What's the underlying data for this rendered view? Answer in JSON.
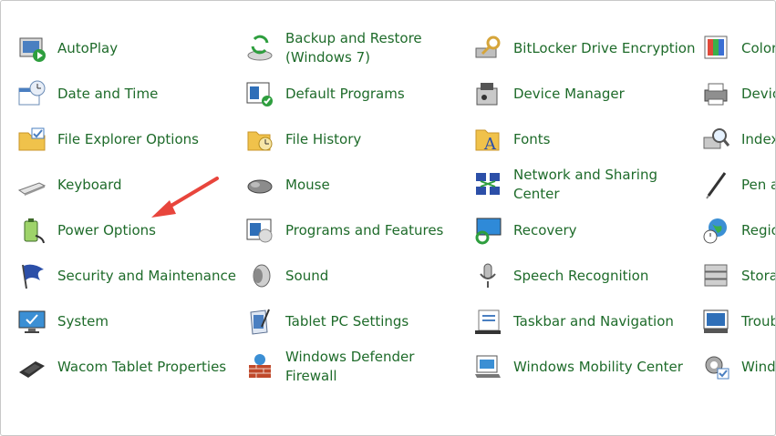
{
  "control_panel": {
    "columns": [
      {
        "items": [
          {
            "label": "AutoPlay",
            "icon": "autoplay-icon"
          },
          {
            "label": "Date and Time",
            "icon": "date-time-icon"
          },
          {
            "label": "File Explorer Options",
            "icon": "folder-options-icon"
          },
          {
            "label": "Keyboard",
            "icon": "keyboard-icon"
          },
          {
            "label": "Power Options",
            "icon": "battery-icon"
          },
          {
            "label": "Security and Maintenance",
            "icon": "flag-icon"
          },
          {
            "label": "System",
            "icon": "monitor-check-icon"
          },
          {
            "label": "Wacom Tablet Properties",
            "icon": "tablet-icon"
          }
        ]
      },
      {
        "items": [
          {
            "label": "Backup and Restore\n(Windows 7)",
            "icon": "backup-icon"
          },
          {
            "label": "Default Programs",
            "icon": "default-programs-icon"
          },
          {
            "label": "File History",
            "icon": "file-history-icon"
          },
          {
            "label": "Mouse",
            "icon": "mouse-icon"
          },
          {
            "label": "Programs and Features",
            "icon": "programs-icon"
          },
          {
            "label": "Sound",
            "icon": "speaker-icon"
          },
          {
            "label": "Tablet PC Settings",
            "icon": "tablet-pen-icon"
          },
          {
            "label": "Windows Defender\nFirewall",
            "icon": "firewall-icon"
          }
        ]
      },
      {
        "items": [
          {
            "label": "BitLocker Drive Encryption",
            "icon": "bitlocker-icon"
          },
          {
            "label": "Device Manager",
            "icon": "device-manager-icon"
          },
          {
            "label": "Fonts",
            "icon": "fonts-icon"
          },
          {
            "label": "Network and Sharing\nCenter",
            "icon": "network-icon"
          },
          {
            "label": "Recovery",
            "icon": "recovery-icon"
          },
          {
            "label": "Speech Recognition",
            "icon": "microphone-icon"
          },
          {
            "label": "Taskbar and Navigation",
            "icon": "taskbar-icon"
          },
          {
            "label": "Windows Mobility Center",
            "icon": "mobility-icon"
          }
        ]
      },
      {
        "items": [
          {
            "label": "Color Management",
            "icon": "color-icon"
          },
          {
            "label": "Devices and Printers",
            "icon": "printer-icon"
          },
          {
            "label": "Indexing Options",
            "icon": "indexing-icon"
          },
          {
            "label": "Pen and Touch",
            "icon": "pen-icon"
          },
          {
            "label": "Region",
            "icon": "globe-clock-icon"
          },
          {
            "label": "Storage Spaces",
            "icon": "storage-icon"
          },
          {
            "label": "Troubleshooting",
            "icon": "troubleshoot-icon"
          },
          {
            "label": "Windows Tools",
            "icon": "gear-icon"
          }
        ]
      }
    ]
  },
  "annotation": {
    "color": "#e8453c"
  }
}
